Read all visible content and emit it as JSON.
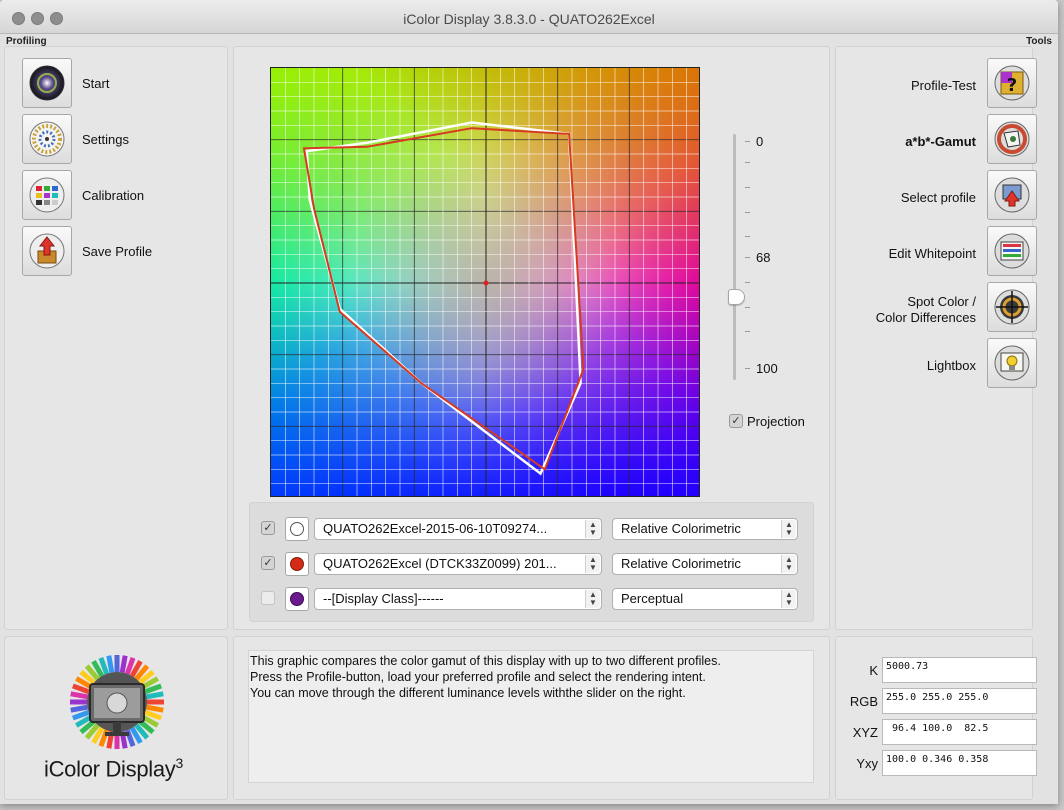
{
  "window": {
    "title": "iColor Display 3.8.3.0 - QUATO262Excel"
  },
  "left": {
    "section_label": "Profiling",
    "buttons": [
      {
        "label": "Start",
        "icon": "start-icon"
      },
      {
        "label": "Settings",
        "icon": "settings-icon"
      },
      {
        "label": "Calibration",
        "icon": "calibration-icon"
      },
      {
        "label": "Save Profile",
        "icon": "save-profile-icon"
      }
    ]
  },
  "right": {
    "section_label": "Tools",
    "buttons": [
      {
        "label": "Profile-Test",
        "icon": "profile-test-icon"
      },
      {
        "label": "a*b*-Gamut",
        "icon": "gamut-icon"
      },
      {
        "label": "Select profile",
        "icon": "select-profile-icon"
      },
      {
        "label": "Edit Whitepoint",
        "icon": "edit-whitepoint-icon"
      },
      {
        "label_line1": "Spot Color /",
        "label_line2": "Color Differences",
        "icon": "spot-color-icon"
      },
      {
        "label": "Lightbox",
        "icon": "lightbox-icon"
      }
    ]
  },
  "gamut": {
    "slider": {
      "top_label": "0",
      "mid_label": "68",
      "bottom_label": "100",
      "value": 68
    },
    "projection_label": "Projection",
    "projection_checked": true,
    "white_outline": [
      [
        -82,
        98
      ],
      [
        -10,
        112
      ],
      [
        58,
        104
      ],
      [
        66,
        -70
      ],
      [
        38,
        -133
      ],
      [
        -45,
        -70
      ],
      [
        -102,
        -18
      ],
      [
        -123,
        58
      ],
      [
        -125,
        92
      ]
    ],
    "red_outline": [
      [
        -83,
        95
      ],
      [
        -10,
        108
      ],
      [
        58,
        104
      ],
      [
        68,
        -60
      ],
      [
        41,
        -130
      ],
      [
        -45,
        -70
      ],
      [
        -102,
        -20
      ],
      [
        -120,
        52
      ],
      [
        -127,
        94
      ]
    ],
    "outline_colors": {
      "white": "#ffffff",
      "red": "#d63a20"
    }
  },
  "profiles": [
    {
      "checked": true,
      "swatch": "#ffffff",
      "name": "QUATO262Excel-2015-06-10T09274...",
      "intent": "Relative Colorimetric"
    },
    {
      "checked": true,
      "swatch": "#d42a18",
      "name": "QUATO262Excel (DTCK33Z0099) 201...",
      "intent": "Relative Colorimetric"
    },
    {
      "checked": false,
      "swatch": "#6a1a8c",
      "name": "--[Display Class]------",
      "intent": "Perceptual"
    }
  ],
  "description": "This graphic compares the color gamut of this display with up to two different profiles.\nPress the Profile-button, load your preferred profile and select the rendering intent.\nYou can move through the different luminance levels withthe slider on the right.",
  "values": [
    {
      "label": "K",
      "value": "5000.73"
    },
    {
      "label": "RGB",
      "value": "255.0 255.0 255.0"
    },
    {
      "label": "XYZ",
      "value": " 96.4 100.0  82.5"
    },
    {
      "label": "Yxy",
      "value": "100.0 0.346 0.358"
    }
  ],
  "logo": {
    "text": "iColor Display",
    "sup": "3"
  }
}
